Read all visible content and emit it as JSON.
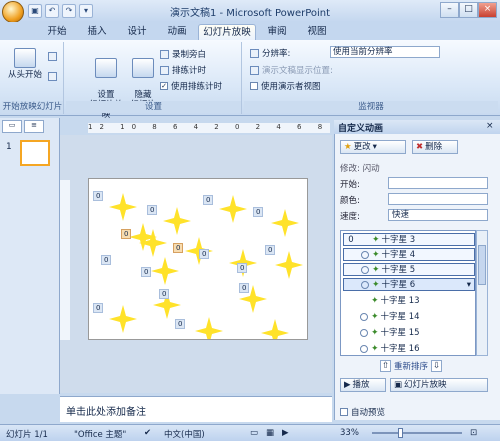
{
  "window": {
    "title": "演示文稿1 - Microsoft PowerPoint"
  },
  "quick_access": {
    "undo": "↶",
    "redo": "↷",
    "save": "▣",
    "more": "▾"
  },
  "tabs": [
    {
      "label": "开始"
    },
    {
      "label": "插入"
    },
    {
      "label": "设计"
    },
    {
      "label": "动画"
    },
    {
      "label": "幻灯片放映",
      "active": true
    },
    {
      "label": "审阅"
    },
    {
      "label": "视图"
    }
  ],
  "ribbon": {
    "group1": {
      "label": "开始放映幻灯片",
      "btn_from_start": "从头开始"
    },
    "group2": {
      "label": "设置",
      "btn_setup": "设置\n幻灯片放映",
      "btn_hide": "隐藏\n幻灯片",
      "record": "录制旁白",
      "rehearse": "排练计时",
      "use_timing": "使用排练计时"
    },
    "group3": {
      "label": "监视器",
      "resolution_label": "分辨率:",
      "resolution_value": "使用当前分辨率",
      "show_on_label": "演示文稿显示位置:",
      "presenter_view": "使用演示者视图"
    }
  },
  "left_panel": {
    "slide_number": "1"
  },
  "ruler": {
    "marks": "12 10 8 6 4 2 0 2 4 6 8 10 12"
  },
  "slide": {
    "labels": [
      {
        "text": "0"
      },
      {
        "text": "0"
      },
      {
        "text": "0"
      },
      {
        "text": "0"
      },
      {
        "text": "0"
      },
      {
        "text": "0"
      },
      {
        "text": "0"
      },
      {
        "text": "0"
      },
      {
        "text": "0"
      },
      {
        "text": "0"
      },
      {
        "text": "0"
      },
      {
        "text": "0"
      },
      {
        "text": "0"
      },
      {
        "text": "0"
      },
      {
        "text": "0"
      }
    ]
  },
  "notes": {
    "placeholder": "单击此处添加备注"
  },
  "task_pane": {
    "title": "自定义动画",
    "change_button": "更改",
    "delete_button": "删除",
    "modify_label": "修改: 闪动",
    "start_label": "开始:",
    "color_label": "颜色:",
    "speed_label": "速度:",
    "speed_value": "快速",
    "reorder_label": "重新排序",
    "play_button": "播放",
    "slideshow_button": "幻灯片放映",
    "autopreview_label": "自动预览",
    "items": [
      {
        "order": "0",
        "name": "十字星 3"
      },
      {
        "name": "十字星 4"
      },
      {
        "name": "十字星 5"
      },
      {
        "name": "十字星 6"
      },
      {
        "name": "十字星 13"
      },
      {
        "name": "十字星 14"
      },
      {
        "name": "十字星 15"
      },
      {
        "name": "十字星 16"
      }
    ]
  },
  "status": {
    "slide_info": "幻灯片 1/1",
    "theme": "\"Office 主题\"",
    "language": "中文(中国)",
    "zoom": "33%"
  },
  "colors": {
    "star": "#ffe22a",
    "accent": "#f5a623"
  }
}
